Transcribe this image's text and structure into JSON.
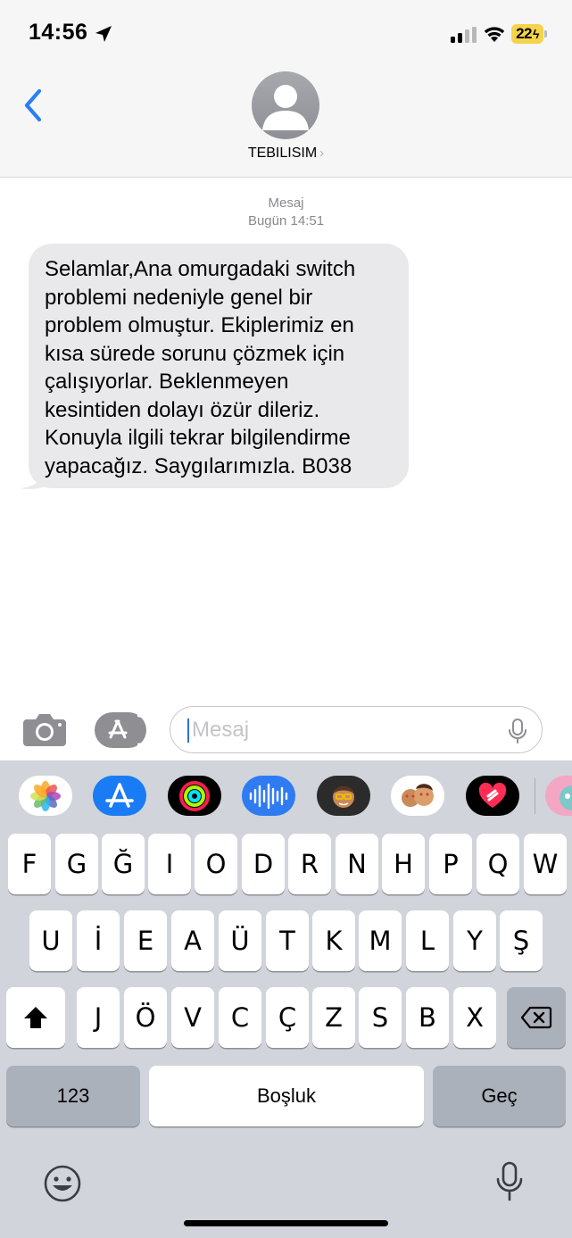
{
  "status_bar": {
    "time": "14:56",
    "battery": "22"
  },
  "header": {
    "contact_name": "TEBILISIM",
    "chevron": "›"
  },
  "conversation": {
    "service_label": "Mesaj",
    "date_label": "Bugün 14:51",
    "messages": [
      {
        "direction": "incoming",
        "text": "Selamlar,Ana omurgadaki switch\nproblemi nedeniyle genel bir\nproblem olmuştur. Ekiplerimiz en\nkısa sürede sorunu çözmek için\nçalışıyorlar. Beklenmeyen\nkesintiden dolayı özür dileriz.\nKonuyla ilgili tekrar bilgilendirme\nyapacağız. Saygılarımızla. B038"
      }
    ]
  },
  "input": {
    "placeholder": "Mesaj",
    "value": ""
  },
  "app_strip": {
    "icons": [
      "photos-icon",
      "app-store-icon",
      "activity-icon",
      "audio-message-icon",
      "memoji-icon",
      "memoji-stickers-icon",
      "digital-touch-icon",
      "talking-tom-icon"
    ]
  },
  "keyboard": {
    "row1": [
      "F",
      "G",
      "Ğ",
      "I",
      "O",
      "D",
      "R",
      "N",
      "H",
      "P",
      "Q",
      "W"
    ],
    "row2": [
      "U",
      "İ",
      "E",
      "A",
      "Ü",
      "T",
      "K",
      "M",
      "L",
      "Y",
      "Ş"
    ],
    "row3": [
      "J",
      "Ö",
      "V",
      "C",
      "Ç",
      "Z",
      "S",
      "B",
      "X"
    ],
    "numbers_label": "123",
    "space_label": "Boşluk",
    "return_label": "Geç"
  }
}
